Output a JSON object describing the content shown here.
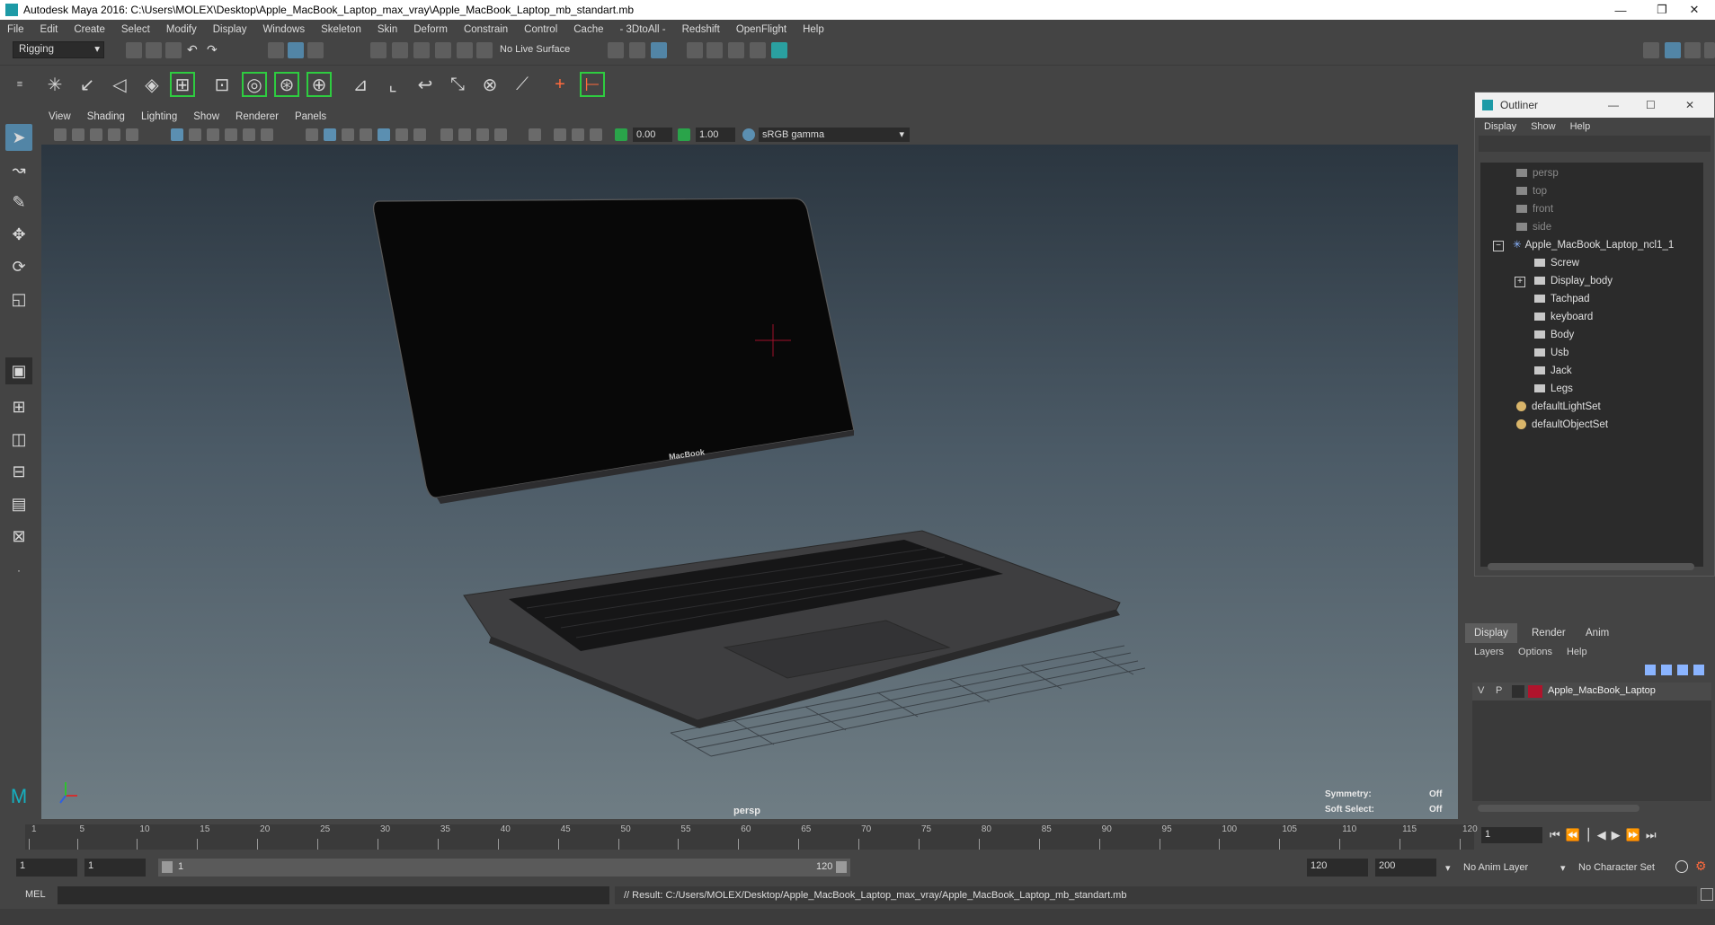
{
  "window": {
    "title": "Autodesk Maya 2016: C:\\Users\\MOLEX\\Desktop\\Apple_MacBook_Laptop_max_vray\\Apple_MacBook_Laptop_mb_standart.mb",
    "minimize": "—",
    "restore": "❐",
    "close": "✕"
  },
  "menubar": [
    "File",
    "Edit",
    "Create",
    "Select",
    "Modify",
    "Display",
    "Windows",
    "Skeleton",
    "Skin",
    "Deform",
    "Constrain",
    "Control",
    "Cache",
    "- 3DtoAll -",
    "Redshift",
    "OpenFlight",
    "Help"
  ],
  "statusline": {
    "mode_dropdown": "Rigging",
    "live_surface": "No Live Surface"
  },
  "panel": {
    "menus": [
      "View",
      "Shading",
      "Lighting",
      "Show",
      "Renderer",
      "Panels"
    ],
    "exposure": "0.00",
    "gamma": "1.00",
    "color_space": "sRGB gamma"
  },
  "viewport": {
    "camera_label": "persp",
    "macbook_label": "MacBook",
    "symmetry_label": "Symmetry:",
    "symmetry_value": "Off",
    "soft_select_label": "Soft Select:",
    "soft_select_value": "Off"
  },
  "outliner": {
    "title": "Outliner",
    "menus": [
      "Display",
      "Show",
      "Help"
    ],
    "items": [
      {
        "label": "persp",
        "type": "camera",
        "dim": true
      },
      {
        "label": "top",
        "type": "camera",
        "dim": true
      },
      {
        "label": "front",
        "type": "camera",
        "dim": true
      },
      {
        "label": "side",
        "type": "camera",
        "dim": true
      },
      {
        "label": "Apple_MacBook_Laptop_ncl1_1",
        "type": "group",
        "dim": false
      },
      {
        "label": "Screw",
        "type": "mesh",
        "dim": false
      },
      {
        "label": "Display_body",
        "type": "mesh",
        "dim": false
      },
      {
        "label": "Tachpad",
        "type": "mesh",
        "dim": false
      },
      {
        "label": "keyboard",
        "type": "mesh",
        "dim": false
      },
      {
        "label": "Body",
        "type": "mesh",
        "dim": false
      },
      {
        "label": "Usb",
        "type": "mesh",
        "dim": false
      },
      {
        "label": "Jack",
        "type": "mesh",
        "dim": false
      },
      {
        "label": "Legs",
        "type": "mesh",
        "dim": false
      },
      {
        "label": "defaultLightSet",
        "type": "set",
        "dim": false
      },
      {
        "label": "defaultObjectSet",
        "type": "set",
        "dim": false
      }
    ]
  },
  "layer_editor": {
    "tabs": [
      "Display",
      "Render",
      "Anim"
    ],
    "menus": [
      "Layers",
      "Options",
      "Help"
    ],
    "layer": {
      "v": "V",
      "p": "P",
      "name": "Apple_MacBook_Laptop",
      "color": "#b0142c"
    }
  },
  "timeline": {
    "ticks": [
      "1",
      "5",
      "10",
      "15",
      "20",
      "25",
      "30",
      "35",
      "40",
      "45",
      "50",
      "55",
      "60",
      "65",
      "70",
      "75",
      "80",
      "85",
      "90",
      "95",
      "100",
      "105",
      "110",
      "115",
      "120"
    ],
    "current_frame": "1"
  },
  "range": {
    "start": "1",
    "playback_start": "1",
    "slider_start": "1",
    "slider_end": "120",
    "playback_end": "120",
    "end": "200",
    "anim_layer": "No Anim Layer",
    "character_set": "No Character Set"
  },
  "commandline": {
    "lang": "MEL",
    "result": "// Result: C:/Users/MOLEX/Desktop/Apple_MacBook_Laptop_max_vray/Apple_MacBook_Laptop_mb_standart.mb"
  },
  "colors": {
    "accent": "#5285a6",
    "shelf_highlight": "#2ecc40",
    "layer_color": "#b0142c"
  }
}
